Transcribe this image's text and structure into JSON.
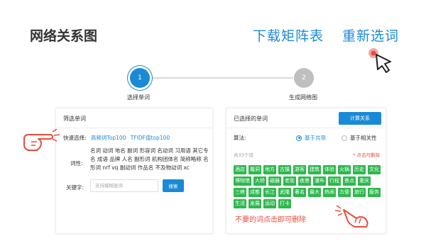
{
  "header": {
    "title": "网络关系图",
    "download_label": "下载矩阵表",
    "reselect_label": "重新选词"
  },
  "stepper": {
    "steps": [
      {
        "number": "1",
        "label": "选择单词",
        "active": true
      },
      {
        "number": "2",
        "label": "生成网络图",
        "active": false
      }
    ]
  },
  "filter_panel": {
    "title": "筛选单词",
    "quick_label": "快速选择:",
    "quick_links": [
      "高频词Top100",
      "TFIDF值top100"
    ],
    "pos_label": "词性:",
    "pos_values": "名词 动词 地名 副词 形容词 名动词 习用语 其它专名 成语 品牌 人名 副形词 机构团体名 简称略称 名形词 nrf vq 副动词 作品名 不及物动词 xc",
    "keyword_label": "关键字:",
    "keyword_placeholder": "支持模糊查询",
    "search_label": "搜索"
  },
  "selected_panel": {
    "title": "已选择的单词",
    "calc_label": "计算关系",
    "algo_label": "算法:",
    "algo_options": [
      {
        "label": "基于共现",
        "selected": true
      },
      {
        "label": "基于相关性",
        "selected": false
      }
    ],
    "count_text": "共33个词",
    "hint_text": "* 点击可删除",
    "tags": [
      "酒店",
      "履洞",
      "地方",
      "古镇",
      "游客",
      "建筑",
      "体验",
      "火锅",
      "历史",
      "文化",
      "博物馆",
      "大桥",
      "磁器",
      "老街",
      "夜景",
      "瀑布",
      "行程",
      "景点",
      "重庆",
      "三峡",
      "成都",
      "长江",
      "武隆",
      "著名",
      "最大",
      "热闹",
      "方便",
      "旅行",
      "服务",
      "生活",
      "发展",
      "运动",
      "打卡"
    ],
    "delete_note": "不要的词点击即可删除"
  },
  "colors": {
    "accent": "#1a8ad6",
    "tag_green": "#2db84d",
    "note_red": "#e74c3c"
  },
  "icons": [
    "click-cursor-icon",
    "pointing-hand-icon"
  ]
}
